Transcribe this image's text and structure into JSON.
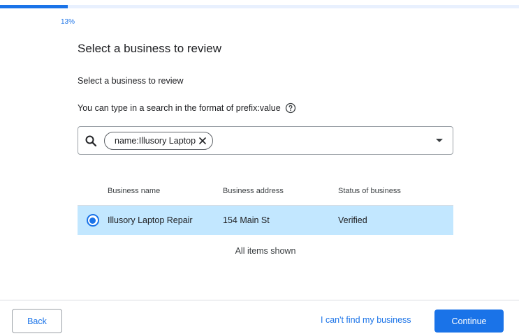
{
  "progress": {
    "percent": 13,
    "label": "13%"
  },
  "page": {
    "title": "Select a business to review",
    "subtitle": "Select a business to review",
    "hint": "You can type in a search in the format of prefix:value"
  },
  "search": {
    "chip_text": "name:Illusory Laptop",
    "icons": {
      "search": "search-icon",
      "remove": "close-icon",
      "dropdown": "dropdown-arrow-icon",
      "help": "help-circle-icon"
    }
  },
  "table": {
    "headers": [
      "Business name",
      "Business address",
      "Status of business"
    ],
    "rows": [
      {
        "selected": true,
        "name": "Illusory Laptop Repair",
        "address": "154 Main St",
        "status": "Verified"
      }
    ],
    "footer": "All items shown"
  },
  "footer": {
    "back_label": "Back",
    "cant_find_label": "I can't find my business",
    "continue_label": "Continue"
  },
  "colors": {
    "accent": "#1a73e8",
    "selected_row": "#c2e7ff",
    "track": "#e8f0fe"
  }
}
